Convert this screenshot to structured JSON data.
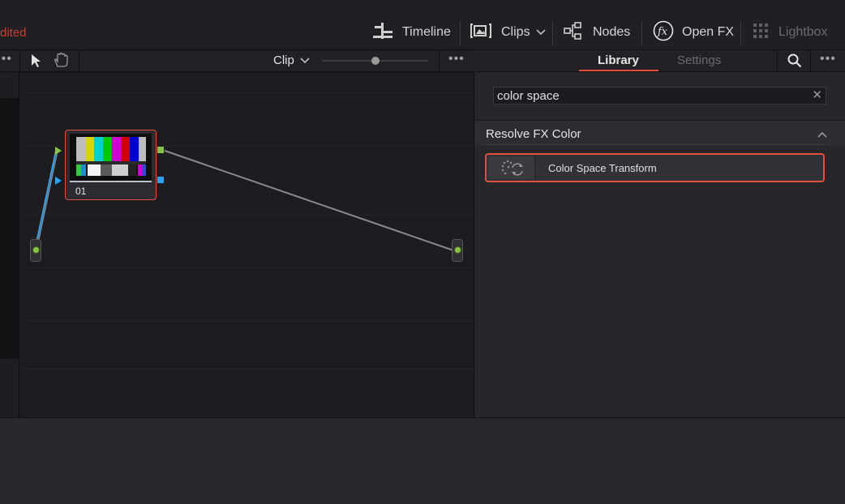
{
  "status": {
    "edited_text": "dited"
  },
  "toolbar": {
    "timeline_label": "Timeline",
    "clips_label": "Clips",
    "nodes_label": "Nodes",
    "openfx_label": "Open FX",
    "lightbox_label": "Lightbox"
  },
  "node_editor": {
    "mode_label": "Clip",
    "zoom_level": 0.5,
    "node_label": "01"
  },
  "library": {
    "tab_library": "Library",
    "tab_settings": "Settings",
    "search_value": "color space",
    "category_title": "Resolve FX Color",
    "items": [
      {
        "label": "Color Space Transform"
      }
    ]
  },
  "colors": {
    "accent": "#e0503c",
    "edited": "#d23b2c",
    "link_line": "#8a8a8a",
    "port_green": "#8bc34a",
    "port_blue": "#2ea3f2"
  },
  "icons": [
    "cursor-icon",
    "hand-icon",
    "more-icon",
    "search-icon",
    "timeline-icon",
    "clips-icon",
    "nodes-icon",
    "openfx-icon",
    "lightbox-icon",
    "chevron-down-icon",
    "chevron-up-icon",
    "close-icon",
    "color-space-transform-icon"
  ]
}
